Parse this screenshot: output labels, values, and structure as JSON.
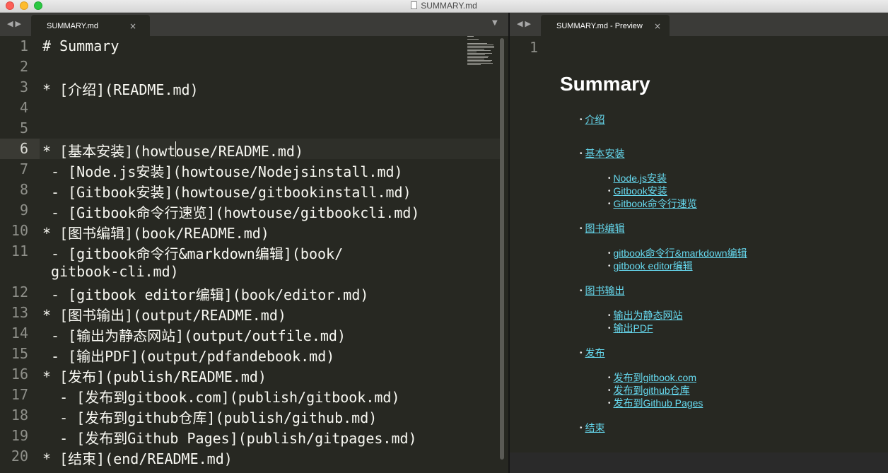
{
  "window": {
    "title": "SUMMARY.md"
  },
  "editor": {
    "tab_label": "SUMMARY.md",
    "current_line": 6,
    "lines": [
      {
        "num": "1",
        "text": "# Summary"
      },
      {
        "num": "2",
        "text": ""
      },
      {
        "num": "3",
        "text": "* [介绍](README.md)"
      },
      {
        "num": "4",
        "text": ""
      },
      {
        "num": "5",
        "text": ""
      },
      {
        "num": "6",
        "text": "* [基本安装](howtouse/README.md)"
      },
      {
        "num": "7",
        "text": " - [Node.js安装](howtouse/Nodejsinstall.md)"
      },
      {
        "num": "8",
        "text": " - [Gitbook安装](howtouse/gitbookinstall.md)"
      },
      {
        "num": "9",
        "text": " - [Gitbook命令行速览](howtouse/gitbookcli.md)"
      },
      {
        "num": "10",
        "text": "* [图书编辑](book/README.md)"
      },
      {
        "num": "11",
        "text": " - [gitbook命令行&markdown编辑](book/"
      },
      {
        "num": "",
        "text": " gitbook-cli.md)"
      },
      {
        "num": "12",
        "text": " - [gitbook editor编辑](book/editor.md)"
      },
      {
        "num": "13",
        "text": "* [图书输出](output/README.md)"
      },
      {
        "num": "14",
        "text": " - [输出为静态网站](output/outfile.md)"
      },
      {
        "num": "15",
        "text": " - [输出PDF](output/pdfandebook.md)"
      },
      {
        "num": "16",
        "text": "* [发布](publish/README.md)"
      },
      {
        "num": "17",
        "text": "  - [发布到gitbook.com](publish/gitbook.md)"
      },
      {
        "num": "18",
        "text": "  - [发布到github仓库](publish/github.md)"
      },
      {
        "num": "19",
        "text": "  - [发布到Github Pages](publish/gitpages.md)"
      },
      {
        "num": "20",
        "text": "* [结束](end/README.md)"
      }
    ]
  },
  "preview": {
    "tab_label": "SUMMARY.md - Preview",
    "line_number": "1",
    "heading": "Summary",
    "items": [
      {
        "text": "介绍",
        "level": 1
      },
      {
        "text": "基本安装",
        "level": 1
      },
      {
        "text": "Node.js安装",
        "level": 2
      },
      {
        "text": "Gitbook安装",
        "level": 2
      },
      {
        "text": "Gitbook命令行速览",
        "level": 2
      },
      {
        "text": "图书编辑",
        "level": 1
      },
      {
        "text": "gitbook命令行&markdown编辑",
        "level": 2
      },
      {
        "text": "gitbook editor编辑",
        "level": 2
      },
      {
        "text": "图书输出",
        "level": 1
      },
      {
        "text": "输出为静态网站",
        "level": 2
      },
      {
        "text": "输出PDF",
        "level": 2
      },
      {
        "text": "发布",
        "level": 1
      },
      {
        "text": "发布到gitbook.com",
        "level": 2
      },
      {
        "text": "发布到github仓库",
        "level": 2
      },
      {
        "text": "发布到Github Pages",
        "level": 2
      },
      {
        "text": "结束",
        "level": 1
      }
    ]
  },
  "icons": {
    "close": "×",
    "nav_back": "◀",
    "nav_forward": "▶",
    "dropdown": "▼",
    "bullet": "•"
  },
  "colors": {
    "editor_bg": "#272822",
    "text": "#f8f8f2",
    "line_number": "#8f908a",
    "link": "#66d9ef",
    "tabbar_bg": "#3b3b38"
  }
}
